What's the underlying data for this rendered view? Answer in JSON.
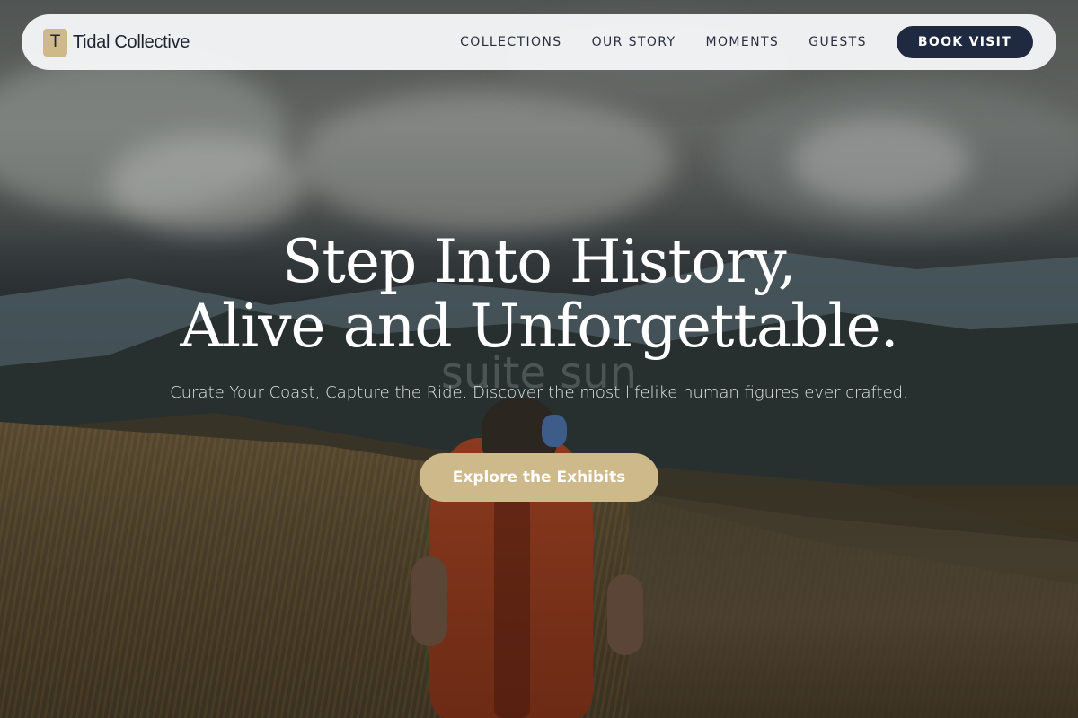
{
  "brand": {
    "mark": "T",
    "name": "Tidal Collective"
  },
  "nav": {
    "links": [
      "COLLECTIONS",
      "OUR STORY",
      "MOMENTS",
      "GUESTS"
    ],
    "cta_label": "BOOK VISIT"
  },
  "hero": {
    "title_line1": "Step Into History,",
    "title_line2": "Alive and Unforgettable.",
    "watermark": "suite sun",
    "subtitle": "Curate Your Coast, Capture the Ride. Discover the most lifelike human figures ever crafted.",
    "cta_label": "Explore the Exhibits"
  },
  "colors": {
    "accent_gold": "#cdb98a",
    "navy": "#1f2940",
    "nav_bg": "#f5f6f7"
  }
}
